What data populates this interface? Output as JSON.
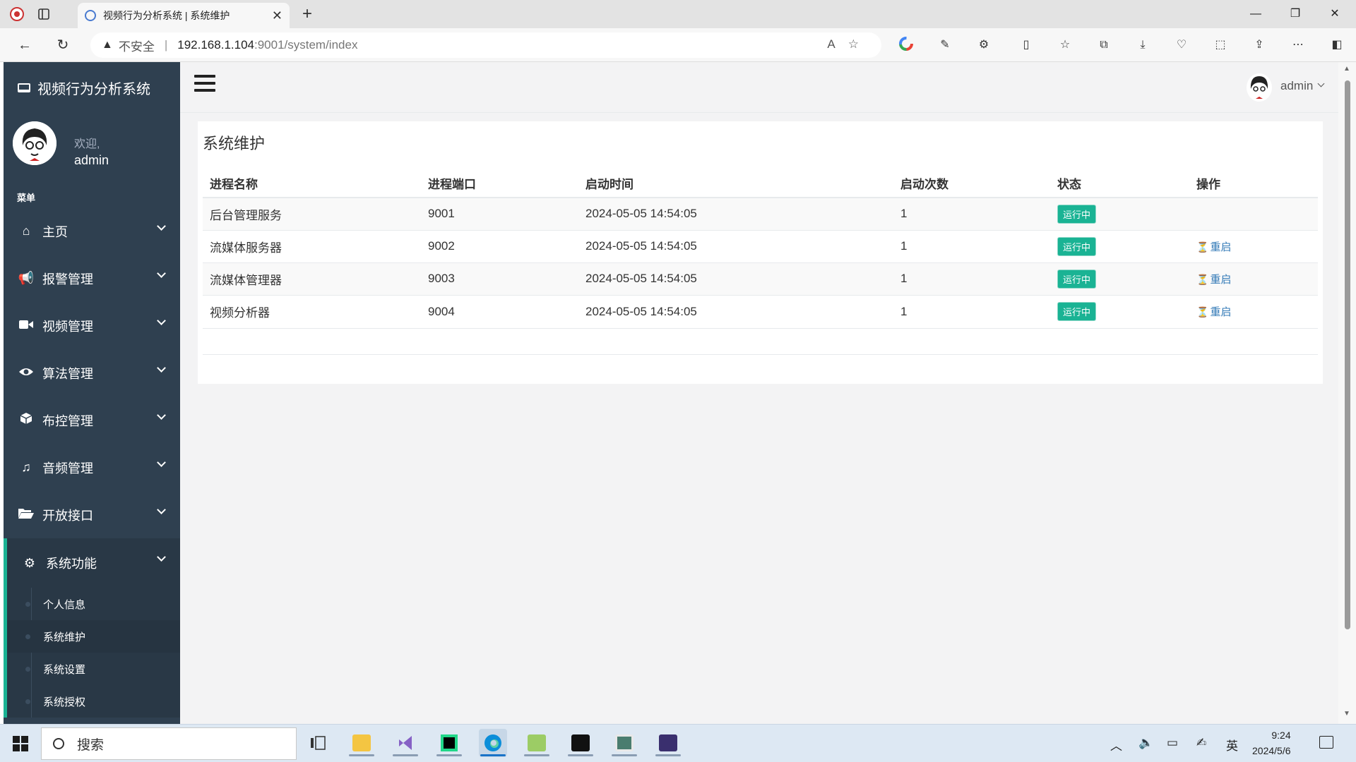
{
  "browser": {
    "tab_title": "视频行为分析系统 | 系统维护",
    "url_security": "不安全",
    "url_host": "192.168.1.104",
    "url_path": ":9001/system/index"
  },
  "sidebar": {
    "brand": "视频行为分析系统",
    "welcome": "欢迎,",
    "username": "admin",
    "menu_heading": "菜单",
    "items": [
      {
        "label": "主页",
        "icon": "home-icon"
      },
      {
        "label": "报警管理",
        "icon": "bullhorn-icon"
      },
      {
        "label": "视频管理",
        "icon": "video-camera-icon"
      },
      {
        "label": "算法管理",
        "icon": "eye-icon"
      },
      {
        "label": "布控管理",
        "icon": "cube-icon"
      },
      {
        "label": "音频管理",
        "icon": "music-icon"
      },
      {
        "label": "开放接口",
        "icon": "folder-open-icon"
      },
      {
        "label": "系统功能",
        "icon": "gear-icon"
      }
    ],
    "submenu": [
      {
        "label": "个人信息"
      },
      {
        "label": "系统维护"
      },
      {
        "label": "系统设置"
      },
      {
        "label": "系统授权"
      }
    ]
  },
  "header": {
    "user": "admin"
  },
  "main": {
    "title": "系统维护",
    "columns": [
      "进程名称",
      "进程端口",
      "启动时间",
      "启动次数",
      "状态",
      "操作"
    ],
    "rows": [
      {
        "name": "后台管理服务",
        "port": "9001",
        "start_time": "2024-05-05 14:54:05",
        "count": "1",
        "status": "运行中",
        "action": ""
      },
      {
        "name": "流媒体服务器",
        "port": "9002",
        "start_time": "2024-05-05 14:54:05",
        "count": "1",
        "status": "运行中",
        "action": "重启"
      },
      {
        "name": "流媒体管理器",
        "port": "9003",
        "start_time": "2024-05-05 14:54:05",
        "count": "1",
        "status": "运行中",
        "action": "重启"
      },
      {
        "name": "视频分析器",
        "port": "9004",
        "start_time": "2024-05-05 14:54:05",
        "count": "1",
        "status": "运行中",
        "action": "重启"
      }
    ]
  },
  "taskbar": {
    "search_placeholder": "搜索",
    "ime": "英",
    "time": "9:24",
    "date": "2024/5/6"
  },
  "colors": {
    "sidebar_bg": "#2f4050",
    "accent": "#1ab394",
    "link": "#337ab7"
  }
}
